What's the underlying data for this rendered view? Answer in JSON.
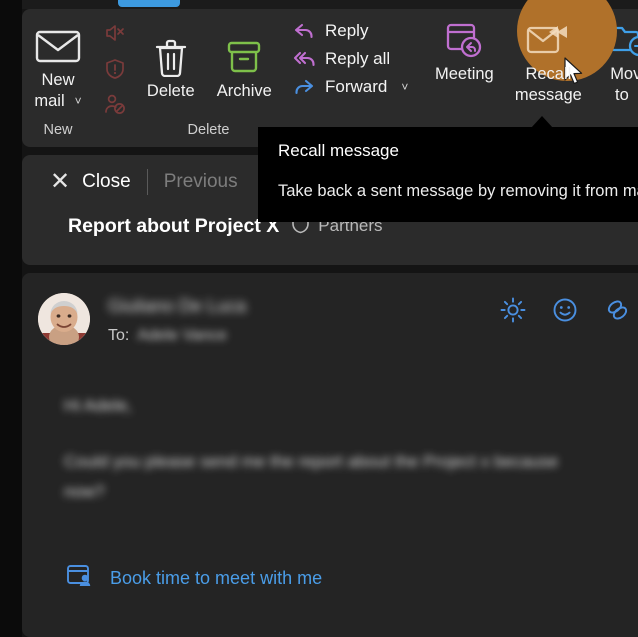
{
  "theme": {
    "accent_blue": "#3d9ae0",
    "highlight_amber": "#b0712a",
    "link_blue": "#4a9de8",
    "ribbon_bg": "#2b2b2b",
    "panel_bg": "#242424",
    "tooltip_bg": "#000000",
    "danger_red": "#7a3b3b",
    "archive_green": "#7ec04a",
    "meeting_purple": "#c06fd0",
    "reply_purple": "#c06fd0"
  },
  "ribbon": {
    "groups": [
      {
        "name": "new",
        "label": "New",
        "buttons": [
          {
            "name": "new-mail",
            "label": "New\nmail",
            "label_line1": "New",
            "label_line2": "mail",
            "icon": "envelope-icon",
            "has_caret": true
          }
        ],
        "mini_icons": [
          {
            "name": "mute-icon",
            "label": "Mute"
          },
          {
            "name": "junk-shield-icon",
            "label": "Junk"
          },
          {
            "name": "block-sender-icon",
            "label": "Block"
          }
        ]
      },
      {
        "name": "delete",
        "label": "Delete",
        "buttons": [
          {
            "name": "delete",
            "label": "Delete",
            "icon": "trash-icon"
          },
          {
            "name": "archive",
            "label": "Archive",
            "icon": "archive-box-icon"
          }
        ]
      },
      {
        "name": "respond",
        "label": "",
        "text_buttons": [
          {
            "name": "reply",
            "label": "Reply",
            "icon": "reply-arrow-icon",
            "has_caret": false
          },
          {
            "name": "reply-all",
            "label": "Reply all",
            "icon": "reply-all-arrow-icon",
            "has_caret": false
          },
          {
            "name": "forward",
            "label": "Forward",
            "icon": "forward-arrow-icon",
            "has_caret": true
          }
        ],
        "buttons": [
          {
            "name": "meeting",
            "label": "Meeting",
            "icon": "calendar-reply-icon"
          },
          {
            "name": "recall-message",
            "label_line1": "Recall",
            "label_line2": "message",
            "icon": "envelope-rewind-icon",
            "highlighted": true
          },
          {
            "name": "move-to",
            "label_line1": "Move",
            "label_line2": "to",
            "icon": "folder-arrow-icon",
            "has_caret": true
          }
        ]
      }
    ]
  },
  "tooltip": {
    "title": "Recall message",
    "description": "Take back a sent message by removing it from mailboxes."
  },
  "reading_pane": {
    "close_label": "Close",
    "close_icon": "close-x-icon",
    "previous_label": "Previous",
    "subject": "Report about Project X",
    "sensitivity_label": "Partners",
    "sensitivity_icon": "shield-icon"
  },
  "message": {
    "avatar_name": "sender-avatar",
    "sender_name": "Giuliano De Luca",
    "to_label": "To:",
    "to_recipient": "Adele Vance",
    "actions": [
      {
        "name": "brightness-icon",
        "label": "Brightness"
      },
      {
        "name": "smiley-reaction-icon",
        "label": "React"
      },
      {
        "name": "loop-components-icon",
        "label": "Loop"
      }
    ],
    "body_lines": [
      "Hi Adele,",
      "Could you please send me the report about the Project x because",
      "now?"
    ],
    "book_link_text": "Book time to meet with me",
    "book_link_icon": "calendar-person-icon"
  }
}
